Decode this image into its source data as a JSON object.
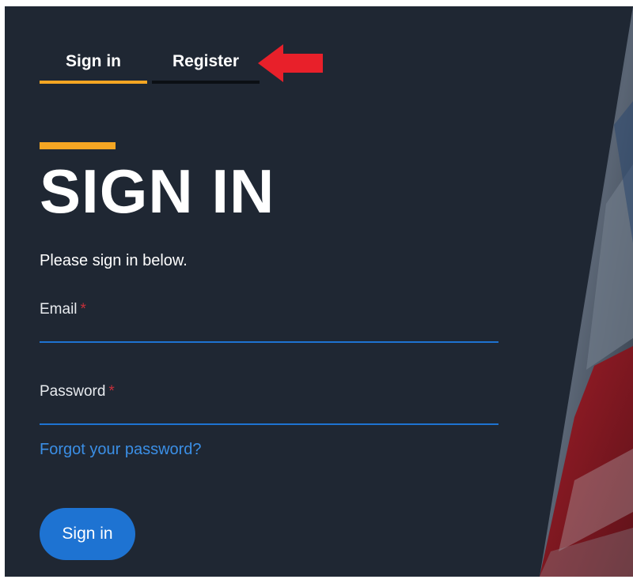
{
  "tabs": [
    {
      "label": "Sign in",
      "active": true
    },
    {
      "label": "Register",
      "active": false
    }
  ],
  "annotation": {
    "icon": "red-arrow-icon",
    "color": "#e8202a"
  },
  "form": {
    "title": "SIGN IN",
    "intro": "Please sign in below.",
    "email_label": "Email",
    "password_label": "Password",
    "required_marker": "*",
    "forgot_link": "Forgot your password?",
    "submit_label": "Sign in"
  },
  "colors": {
    "background": "#1f2733",
    "accent": "#f5a623",
    "primary": "#1e73d2",
    "link": "#3b8fe6",
    "required": "#c62f3a"
  }
}
